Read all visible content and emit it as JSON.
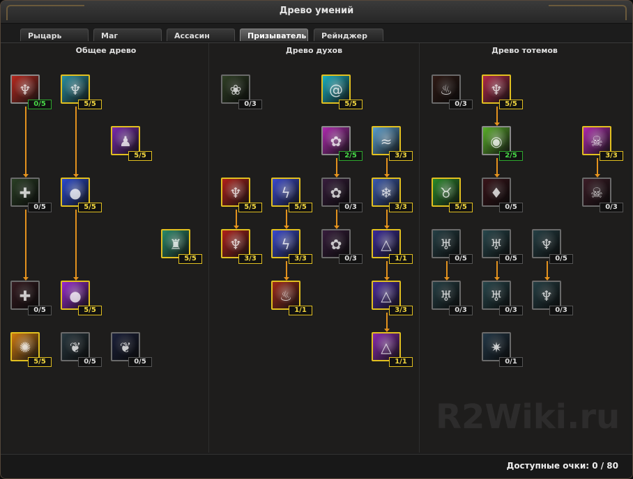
{
  "window": {
    "title": "Древо умений"
  },
  "tabs": [
    {
      "label": "Рыцарь",
      "active": false
    },
    {
      "label": "Маг",
      "active": false
    },
    {
      "label": "Ассасин",
      "active": false
    },
    {
      "label": "Призыватель",
      "active": true
    },
    {
      "label": "Рейнджер",
      "active": false
    }
  ],
  "trees": [
    {
      "title": "Общее древо"
    },
    {
      "title": "Древо духов"
    },
    {
      "title": "Древо тотемов"
    }
  ],
  "skills": [
    {
      "id": "g1",
      "label": "0/5",
      "state": "part",
      "color": "#b8281e",
      "icon": "demon-figure-icon"
    },
    {
      "id": "g2",
      "label": "5/5",
      "state": "full",
      "color": "#2a8fa0",
      "icon": "spirit-figure-icon"
    },
    {
      "id": "g3",
      "label": "5/5",
      "state": "full",
      "color": "#7a2bb0",
      "icon": "dark-mage-icon"
    },
    {
      "id": "g4",
      "label": "0/5",
      "state": "none",
      "color": "#3a7a2a",
      "icon": "holy-cross-icon"
    },
    {
      "id": "g5",
      "label": "5/5",
      "state": "full",
      "color": "#2a4ad0",
      "icon": "water-orbs-icon"
    },
    {
      "id": "g6",
      "label": "5/5",
      "state": "full",
      "color": "#2a8a6a",
      "icon": "shadow-figure-icon"
    },
    {
      "id": "g7",
      "label": "0/5",
      "state": "none",
      "color": "#7a2a3a",
      "icon": "red-cross-icon"
    },
    {
      "id": "g8",
      "label": "5/5",
      "state": "full",
      "color": "#9a2ad0",
      "icon": "arcane-orbs-icon"
    },
    {
      "id": "g9",
      "label": "5/5",
      "state": "full",
      "color": "#d07a10",
      "icon": "fire-sigil-icon"
    },
    {
      "id": "g10",
      "label": "0/5",
      "state": "none",
      "color": "#3a6a80",
      "icon": "ice-tree-icon"
    },
    {
      "id": "g11",
      "label": "0/5",
      "state": "none",
      "color": "#2a3a8a",
      "icon": "blue-tree-icon"
    },
    {
      "id": "s1",
      "label": "0/3",
      "state": "none",
      "color": "#4a7a2a",
      "icon": "nature-spirit-icon"
    },
    {
      "id": "s2",
      "label": "5/5",
      "state": "full",
      "color": "#1ab0c0",
      "icon": "wind-swirl-icon"
    },
    {
      "id": "s3",
      "label": "2/5",
      "state": "part",
      "color": "#b02ab0",
      "icon": "lotus-spirit-icon"
    },
    {
      "id": "s4",
      "label": "3/3",
      "state": "full",
      "color": "#5aa0d0",
      "icon": "sky-wave-icon"
    },
    {
      "id": "s5",
      "label": "5/5",
      "state": "full",
      "color": "#b0201a",
      "icon": "red-demon-icon"
    },
    {
      "id": "s6",
      "label": "5/5",
      "state": "full",
      "color": "#3a4ad0",
      "icon": "lightning-tree-icon"
    },
    {
      "id": "s7",
      "label": "0/3",
      "state": "none",
      "color": "#7a2a8a",
      "icon": "violet-spirit-icon"
    },
    {
      "id": "s8",
      "label": "3/3",
      "state": "full",
      "color": "#3a5ab0",
      "icon": "frost-figure-icon"
    },
    {
      "id": "s9",
      "label": "3/3",
      "state": "full",
      "color": "#b0201a",
      "icon": "red-demon-icon"
    },
    {
      "id": "s10",
      "label": "3/3",
      "state": "full",
      "color": "#3a4ad0",
      "icon": "lightning-tree-icon"
    },
    {
      "id": "s11",
      "label": "0/3",
      "state": "none",
      "color": "#7a2a8a",
      "icon": "violet-spirit-icon"
    },
    {
      "id": "s12",
      "label": "1/1",
      "state": "full",
      "color": "#3a2a9a",
      "icon": "triad-sigil-icon"
    },
    {
      "id": "s13",
      "label": "1/1",
      "state": "full",
      "color": "#a02a1a",
      "icon": "fire-claw-icon"
    },
    {
      "id": "s14",
      "label": "3/3",
      "state": "full",
      "color": "#4a2aa0",
      "icon": "triad-sigil-icon"
    },
    {
      "id": "s15",
      "label": "1/1",
      "state": "full",
      "color": "#8a2ab0",
      "icon": "triad-sigil-icon"
    },
    {
      "id": "t1",
      "label": "0/3",
      "state": "none",
      "color": "#6a2a1a",
      "icon": "flame-totem-icon"
    },
    {
      "id": "t2",
      "label": "5/5",
      "state": "full",
      "color": "#b02a4a",
      "icon": "red-totem-icon"
    },
    {
      "id": "t3",
      "label": "2/5",
      "state": "part",
      "color": "#5ab02a",
      "icon": "green-orb-icon"
    },
    {
      "id": "t4",
      "label": "3/3",
      "state": "full",
      "color": "#b02ab0",
      "icon": "skull-totem-icon"
    },
    {
      "id": "t5",
      "label": "5/5",
      "state": "full",
      "color": "#2a8a2a",
      "icon": "beast-totem-icon"
    },
    {
      "id": "t6",
      "label": "0/5",
      "state": "none",
      "color": "#8a1a2a",
      "icon": "blood-drop-icon"
    },
    {
      "id": "t7",
      "label": "0/3",
      "state": "none",
      "color": "#8a2a4a",
      "icon": "pink-totem-icon"
    },
    {
      "id": "t8",
      "label": "0/5",
      "state": "none",
      "color": "#2a7a8a",
      "icon": "horned-totem-icon"
    },
    {
      "id": "t9",
      "label": "0/5",
      "state": "none",
      "color": "#2a8a9a",
      "icon": "winged-totem-icon"
    },
    {
      "id": "t10",
      "label": "0/5",
      "state": "none",
      "color": "#2a7a8a",
      "icon": "spire-totem-icon"
    },
    {
      "id": "t11",
      "label": "0/3",
      "state": "none",
      "color": "#2a7a8a",
      "icon": "horned-totem-icon"
    },
    {
      "id": "t12",
      "label": "0/3",
      "state": "none",
      "color": "#2a8a9a",
      "icon": "winged-totem-icon"
    },
    {
      "id": "t13",
      "label": "0/3",
      "state": "none",
      "color": "#2a7a8a",
      "icon": "spire-totem-icon"
    },
    {
      "id": "t14",
      "label": "0/1",
      "state": "none",
      "color": "#2a6a9a",
      "icon": "radiant-totem-icon"
    }
  ],
  "footer": {
    "points_text": "Доступные очки: 0 / 80"
  },
  "watermark": "R2Wiki.ru"
}
